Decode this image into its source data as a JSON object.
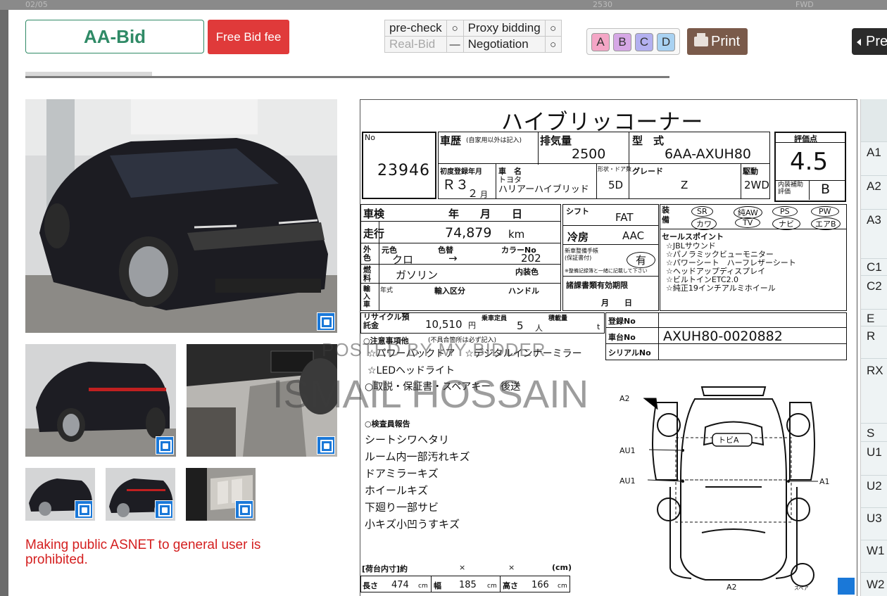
{
  "header": {
    "aa_bid": "AA-Bid",
    "free_bid_fee": "Free Bid fee",
    "status": [
      {
        "label": "pre-check",
        "mark": "○",
        "dim": false
      },
      {
        "label": "Proxy bidding",
        "mark": "○",
        "dim": false
      },
      {
        "label": "Real-Bid",
        "mark": "—",
        "dim": true
      },
      {
        "label": "Negotiation",
        "mark": "○",
        "dim": false
      }
    ],
    "grades": [
      {
        "label": "A",
        "color": "#f4a6c6"
      },
      {
        "label": "B",
        "color": "#d6a8e6"
      },
      {
        "label": "C",
        "color": "#b3b0f0"
      },
      {
        "label": "D",
        "color": "#a9d2f2"
      }
    ],
    "print_label": "Print",
    "prev_label": "Pre"
  },
  "backdrop": {
    "date": "02/05",
    "num": "2530",
    "fwd": "FWD"
  },
  "warning": "Making public ASNET to general user is prohibited.",
  "watermarks": {
    "line1": "POSTED BY MY BIDDER",
    "line2": "ISMAIL HOSSAIN"
  },
  "sheet": {
    "title": "ハイブリッコーナー",
    "lot_no_label": "No",
    "lot_no": "23946",
    "history_label": "車歴",
    "history_note": "(自家用以外は記入)",
    "displacement_label": "排気量",
    "displacement": "2500",
    "model_label": "型　式",
    "model_code": "6AA-AXUH80",
    "score_label": "評価点",
    "score": "4.5",
    "first_reg_label": "初度登録年月",
    "first_reg_year": "Ｒ３",
    "first_reg_month": "２",
    "month_char": "月",
    "car_name_label": "車　名",
    "maker": "トヨタ",
    "car_name": "ハリアーハイブリッド",
    "doors_label": "形状・ドア数",
    "doors": "5D",
    "grade_label": "グレード",
    "grade": "Z",
    "drive_label": "駆動",
    "drive": "2WD",
    "interior_label": "内装補助評価",
    "interior": "B",
    "shaken_label": "車検",
    "shaken_units": "年　　月　　日",
    "mileage_label": "走行",
    "mileage": "74,879",
    "mileage_unit": "km",
    "color_label": "外色",
    "color_orig_label": "元色",
    "color_change_label": "色替",
    "color": "クロ",
    "color_arrow": "→",
    "color_no_label": "カラーNo",
    "color_no": "202",
    "fuel_label": "燃料",
    "fuel": "ガソリン",
    "interior_color_label": "内装色",
    "import_label": "輸入車",
    "import_year_label": "年式",
    "import_class_label": "輸入区分",
    "handle_label": "ハンドル",
    "shift_label": "シフト",
    "shift": "FAT",
    "ac_label": "冷房",
    "ac": "AAC",
    "manual_label": "新車整備手帳(保証書付)",
    "manual_value": "有",
    "manual_note": "※整備記録簿と一緒に記載して下さい",
    "docs_label": "諸課書類有効期限",
    "docs_units": "月　　日",
    "recycle_label": "リサイクル預託金",
    "recycle": "10,510",
    "recycle_unit": "円",
    "capacity_label": "乗車定員",
    "capacity": "5",
    "capacity_unit": "人",
    "load_label": "積載量",
    "load_unit": "t",
    "reg_label": "登録No",
    "chassis_label": "車台No",
    "chassis": "AXUH80-0020882",
    "serial_label": "シリアルNo",
    "equip_label": "装備",
    "equipment": [
      "SR",
      "純AW",
      "PS",
      "PW",
      "カワ",
      "TV",
      "ナビ",
      "エアB"
    ],
    "sales_points_label": "セールスポイント",
    "sales_points": [
      "☆JBLサウンド",
      "☆パノラミックビューモニター",
      "☆パワーシート　ハーフレザーシート",
      "☆ヘッドアップディスプレイ",
      "☆ビルトインETC2.0",
      "☆純正19インチアルミホイール"
    ],
    "notes_label": "○注意事項他",
    "notes_sub": "(不具合箇所は必ず記入)",
    "notes": [
      "☆パワーバックドア　☆デジタルインナーミラー",
      "☆LEDヘッドライト",
      "○取説・保証書・スペアキー　後送"
    ],
    "inspector_label": "○検査員報告",
    "inspector": [
      "シートシワヘタリ",
      "ルーム内一部汚れキズ",
      "ドアミラーキズ",
      "ホイールキズ",
      "下廻り一部サビ",
      "小キズ小凹うすキズ"
    ],
    "cargo_label": "[荷台内寸]約",
    "cargo_x": "×",
    "cargo_unit": "(cm)",
    "dim_length_label": "長さ",
    "dim_length": "474",
    "dim_width_label": "幅",
    "dim_width": "185",
    "dim_height_label": "高さ",
    "dim_height": "166",
    "dim_unit": "cm",
    "diagram_marks": {
      "a2_top": "A2",
      "au1_a": "AU1",
      "au1_b": "AU1",
      "a1": "A1",
      "a2_bottom": "A2",
      "roof": "トビA",
      "spare": "スペア"
    }
  },
  "side_grid": {
    "rows": [
      "A1",
      "A2",
      "A3",
      "C1",
      "C2",
      "E",
      "R",
      "RX",
      "S",
      "U1",
      "U2",
      "U3",
      "W1",
      "W2"
    ]
  }
}
